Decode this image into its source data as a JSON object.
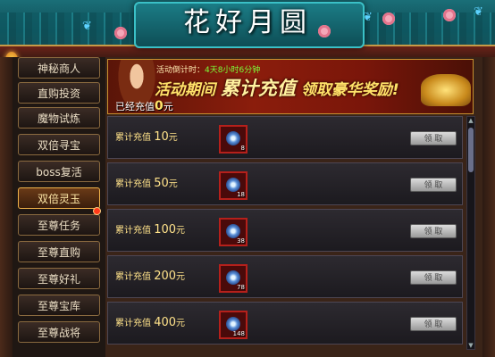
{
  "title": "花好月圆",
  "sidebar": {
    "items": [
      {
        "label": "神秘商人"
      },
      {
        "label": "直购投资"
      },
      {
        "label": "魔物试炼"
      },
      {
        "label": "双倍寻宝"
      },
      {
        "label": "boss复活"
      },
      {
        "label": "双倍灵玉"
      },
      {
        "label": "至尊任务"
      },
      {
        "label": "至尊直购"
      },
      {
        "label": "至尊好礼"
      },
      {
        "label": "至尊宝库"
      },
      {
        "label": "至尊战将"
      }
    ],
    "active_index": 5
  },
  "banner": {
    "countdown_label": "活动倒计时：",
    "countdown_value": "4天8小时6分钟",
    "slogan_prefix": "活动期间",
    "slogan_main": "累计充值",
    "slogan_suffix": "领取豪华奖励!",
    "charged_label": "已经充值",
    "charged_value": "0",
    "charged_unit": "元"
  },
  "rewards": [
    {
      "label": "累计充值",
      "amount": "10",
      "unit": "元",
      "item_qty": "8",
      "button": "领 取"
    },
    {
      "label": "累计充值",
      "amount": "50",
      "unit": "元",
      "item_qty": "18",
      "button": "领 取"
    },
    {
      "label": "累计充值",
      "amount": "100",
      "unit": "元",
      "item_qty": "38",
      "button": "领 取"
    },
    {
      "label": "累计充值",
      "amount": "200",
      "unit": "元",
      "item_qty": "78",
      "button": "领 取"
    },
    {
      "label": "累计充值",
      "amount": "400",
      "unit": "元",
      "item_qty": "148",
      "button": "领 取"
    }
  ],
  "colors": {
    "accent_gold": "#ffe28a",
    "countdown_green": "#7cff3a",
    "active_border": "#f0b24a"
  },
  "icons": [
    "butterfly-icon",
    "flower-icon",
    "lantern-icon",
    "gem-icon"
  ]
}
